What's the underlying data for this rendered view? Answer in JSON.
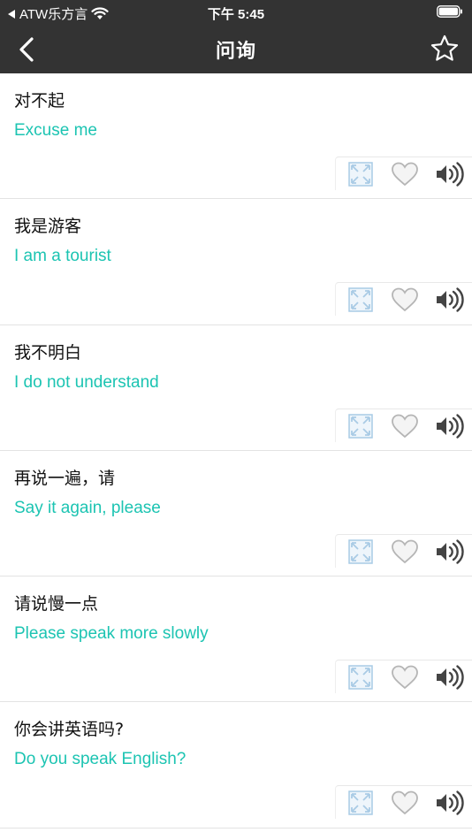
{
  "status": {
    "carrier": "ATW乐方言",
    "time": "下午 5:45"
  },
  "nav": {
    "title": "问询"
  },
  "colors": {
    "header_bg": "#333333",
    "accent": "#1cc4b2",
    "icon_gray": "#a6a6a6",
    "expand_icon": "#a9cbe5"
  },
  "icons": [
    "back-arrow-icon",
    "star-icon",
    "expand-icon",
    "heart-icon",
    "speaker-icon"
  ],
  "phrases": [
    {
      "zh": "对不起",
      "en": "Excuse me"
    },
    {
      "zh": "我是游客",
      "en": "I am a tourist"
    },
    {
      "zh": "我不明白",
      "en": "I do not understand"
    },
    {
      "zh": "再说一遍，请",
      "en": "Say it again, please"
    },
    {
      "zh": "请说慢一点",
      "en": "Please speak more slowly"
    },
    {
      "zh": "你会讲英语吗?",
      "en": "Do you speak English?"
    }
  ]
}
